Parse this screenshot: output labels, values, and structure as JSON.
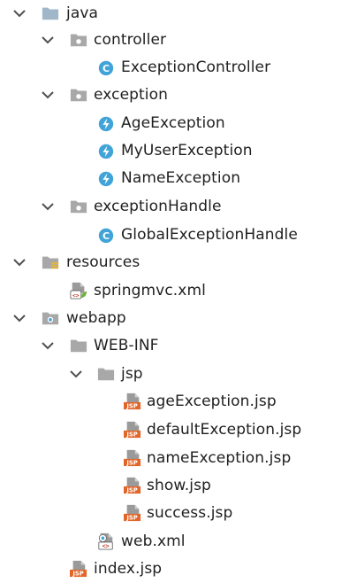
{
  "tree": {
    "nodes": [
      {
        "label": "java",
        "icon": "source-folder-icon",
        "expanded": true
      },
      {
        "label": "controller",
        "icon": "package-icon",
        "expanded": true
      },
      {
        "label": "ExceptionController",
        "icon": "class-icon"
      },
      {
        "label": "exception",
        "icon": "package-icon",
        "expanded": true
      },
      {
        "label": "AgeException",
        "icon": "exception-class-icon"
      },
      {
        "label": "MyUserException",
        "icon": "exception-class-icon"
      },
      {
        "label": "NameException",
        "icon": "exception-class-icon"
      },
      {
        "label": "exceptionHandle",
        "icon": "package-icon",
        "expanded": true
      },
      {
        "label": "GlobalExceptionHandle",
        "icon": "class-icon"
      },
      {
        "label": "resources",
        "icon": "resources-folder-icon",
        "expanded": true
      },
      {
        "label": "springmvc.xml",
        "icon": "spring-xml-icon"
      },
      {
        "label": "webapp",
        "icon": "web-folder-icon",
        "expanded": true
      },
      {
        "label": "WEB-INF",
        "icon": "folder-icon",
        "expanded": true
      },
      {
        "label": "jsp",
        "icon": "folder-icon",
        "expanded": true
      },
      {
        "label": "ageException.jsp",
        "icon": "jsp-file-icon"
      },
      {
        "label": "defaultException.jsp",
        "icon": "jsp-file-icon"
      },
      {
        "label": "nameException.jsp",
        "icon": "jsp-file-icon"
      },
      {
        "label": "show.jsp",
        "icon": "jsp-file-icon"
      },
      {
        "label": "success.jsp",
        "icon": "jsp-file-icon"
      },
      {
        "label": "web.xml",
        "icon": "web-xml-icon"
      },
      {
        "label": "index.jsp",
        "icon": "jsp-file-icon"
      }
    ],
    "jsp_badge": "JSP",
    "class_badge": "C"
  },
  "colors": {
    "chevron": "#505050",
    "folder": "#9fb7c8",
    "class_circle": "#40a4d8",
    "exception_circle": "#40a4d8",
    "jsp_badge": "#e2662a",
    "spring_leaf": "#6db33f"
  }
}
